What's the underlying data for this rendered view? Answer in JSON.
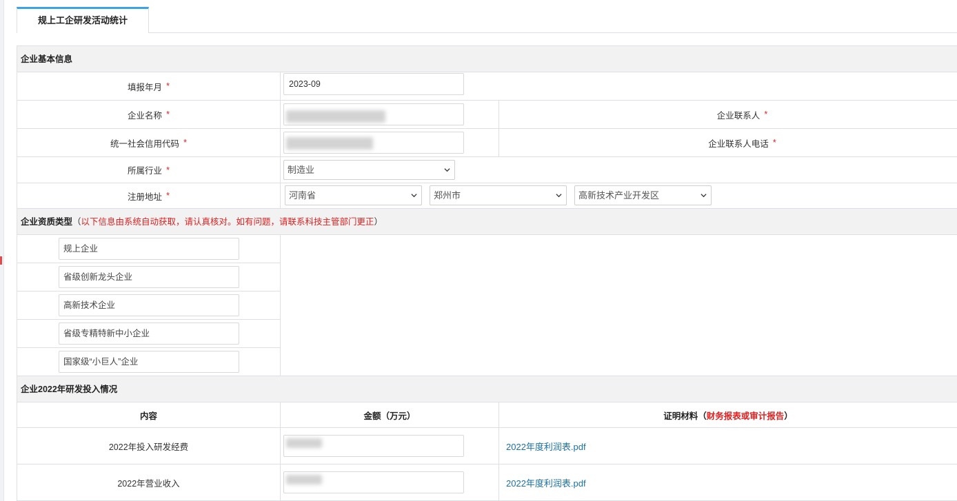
{
  "tab": {
    "title": "规上工企研发活动统计"
  },
  "basic_info": {
    "section_title": "企业基本信息",
    "report_month": {
      "label": "填报年月",
      "required_mark": "*",
      "value": "2023-09"
    },
    "company_name": {
      "label": "企业名称",
      "required_mark": "*"
    },
    "contact_person": {
      "label": "企业联系人",
      "required_mark": "*"
    },
    "credit_code": {
      "label": "统一社会信用代码",
      "required_mark": "*"
    },
    "contact_phone": {
      "label": "企业联系人电话",
      "required_mark": "*"
    },
    "industry": {
      "label": "所属行业",
      "required_mark": "*",
      "selected": "制造业"
    },
    "address": {
      "label": "注册地址",
      "required_mark": "*",
      "province": "河南省",
      "city": "郑州市",
      "district": "高新技术产业开发区"
    }
  },
  "qualification": {
    "section_title": "企业资质类型",
    "paren_open": "（",
    "notice": "以下信息由系统自动获取，请认真核对。如有问题，请联系科技主管部门更正",
    "paren_close": "）",
    "items": [
      "规上企业",
      "省级创新龙头企业",
      "高新技术企业",
      "省级专精特新中小企业",
      "国家级“小巨人”企业"
    ]
  },
  "rd_investment": {
    "section_title": "企业2022年研发投入情况",
    "headers": {
      "content": "内容",
      "amount": "金额（万元）",
      "proof_prefix": "证明材料（",
      "proof_red": "财务报表或审计报告",
      "proof_suffix": "）"
    },
    "rows": [
      {
        "label": "2022年投入研发经费",
        "file": "2022年度利润表.pdf"
      },
      {
        "label": "2022年营业收入",
        "file": "2022年度利润表.pdf"
      }
    ]
  },
  "colors": {
    "accent": "#3aa3e3",
    "required": "#e02020",
    "link": "#1a6fa8",
    "section_bg": "#f2f2f2"
  }
}
